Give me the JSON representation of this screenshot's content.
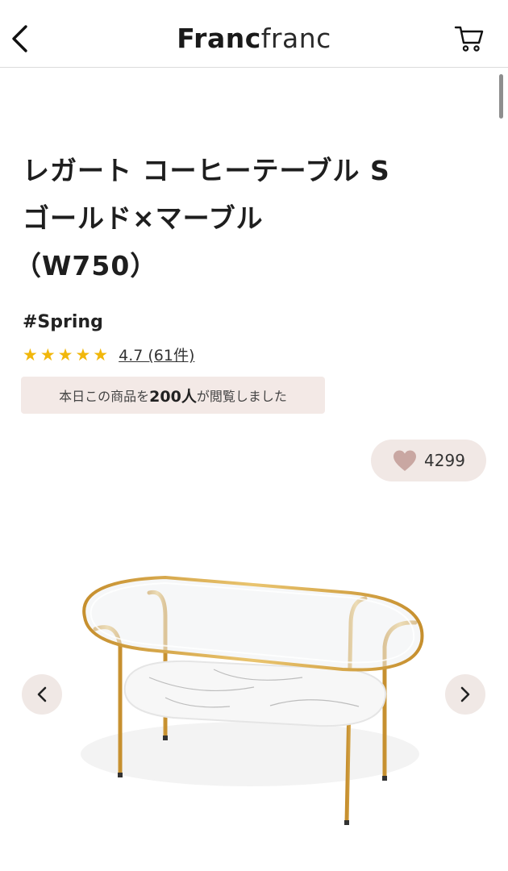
{
  "header": {
    "back_icon": "chevron-left-icon",
    "logo_bold": "Franc",
    "logo_light": "franc",
    "cart_icon": "cart-icon"
  },
  "product": {
    "title_line1": "レガート コーヒーテーブル S",
    "title_line2": "ゴールド×マーブル",
    "title_line3": "（W750）",
    "hashtag": "#Spring",
    "stars": "★★★★★",
    "rating_text": "4.7 (61件)",
    "viewers_prefix": "本日この商品を",
    "viewers_count": "200人",
    "viewers_suffix": "が閲覧しました",
    "favorite_count": "4299"
  },
  "carousel": {
    "prev_icon": "chevron-left-icon",
    "next_icon": "chevron-right-icon"
  },
  "colors": {
    "star": "#f1b70b",
    "pill_bg": "#f1e8e5",
    "heart": "#c9a7a2",
    "gold": "#d9a645"
  }
}
